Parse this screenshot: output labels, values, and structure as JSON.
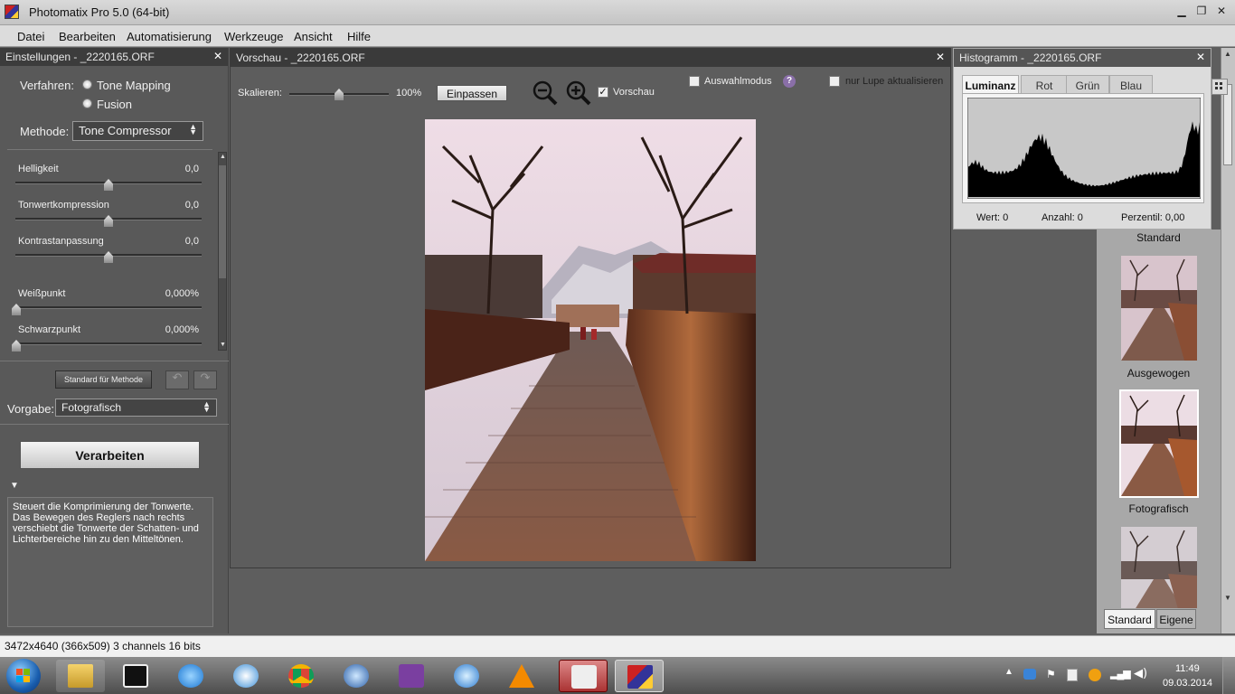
{
  "window": {
    "title": "Photomatix Pro 5.0 (64-bit)"
  },
  "menu": [
    "Datei",
    "Bearbeiten",
    "Automatisierung",
    "Werkzeuge",
    "Ansicht",
    "Hilfe"
  ],
  "settings": {
    "title": "Einstellungen - _2220165.ORF",
    "verfahren_label": "Verfahren:",
    "method_options": [
      "Tone Mapping",
      "Fusion"
    ],
    "methode_label": "Methode:",
    "methode_value": "Tone Compressor",
    "sliders": [
      {
        "label": "Helligkeit",
        "value": "0,0",
        "level": 0.5
      },
      {
        "label": "Tonwertkompression",
        "value": "0,0",
        "level": 0.5
      },
      {
        "label": "Kontrastanpassung",
        "value": "0,0",
        "level": 0.5
      },
      {
        "label": "Weißpunkt",
        "value": "0,000%",
        "level": 0.0
      },
      {
        "label": "Schwarzpunkt",
        "value": "0,000%",
        "level": 0.0
      }
    ],
    "standard_button": "Standard für Methode",
    "vorgabe_label": "Vorgabe:",
    "vorgabe_value": "Fotografisch",
    "process_button": "Verarbeiten",
    "help_text": "Steuert die Komprimierung der Tonwerte. Das Bewegen des Reglers nach rechts verschiebt die Tonwerte der Schatten- und Lichterbereiche hin zu den Mitteltönen."
  },
  "preview": {
    "title": "Vorschau - _2220165.ORF",
    "scale_label": "Skalieren:",
    "scale_value": "100%",
    "fit_button": "Einpassen",
    "preview_checkbox": "Vorschau",
    "selection_mode": "Auswahlmodus",
    "help_icon": "?",
    "magnifier_only": "nur Lupe aktualisieren"
  },
  "histogram": {
    "title": "Histogramm - _2220165.ORF",
    "tabs": [
      "Luminanz",
      "Rot",
      "Grün",
      "Blau"
    ],
    "wert": "Wert: 0",
    "anzahl": "Anzahl: 0",
    "perzentil": "Perzentil: 0,00"
  },
  "presets": {
    "items": [
      "Standard",
      "Ausgewogen",
      "Fotografisch",
      ""
    ],
    "tabs": [
      "Standard",
      "Eigene"
    ]
  },
  "status": {
    "text": "3472x4640 (366x509) 3 channels 16 bits"
  },
  "taskbar": {
    "time": "11:49",
    "date": "09.03.2014"
  },
  "colors": {
    "panel": "#595959",
    "title": "#3c3c3c",
    "accent_wood": "#7a4a35"
  }
}
